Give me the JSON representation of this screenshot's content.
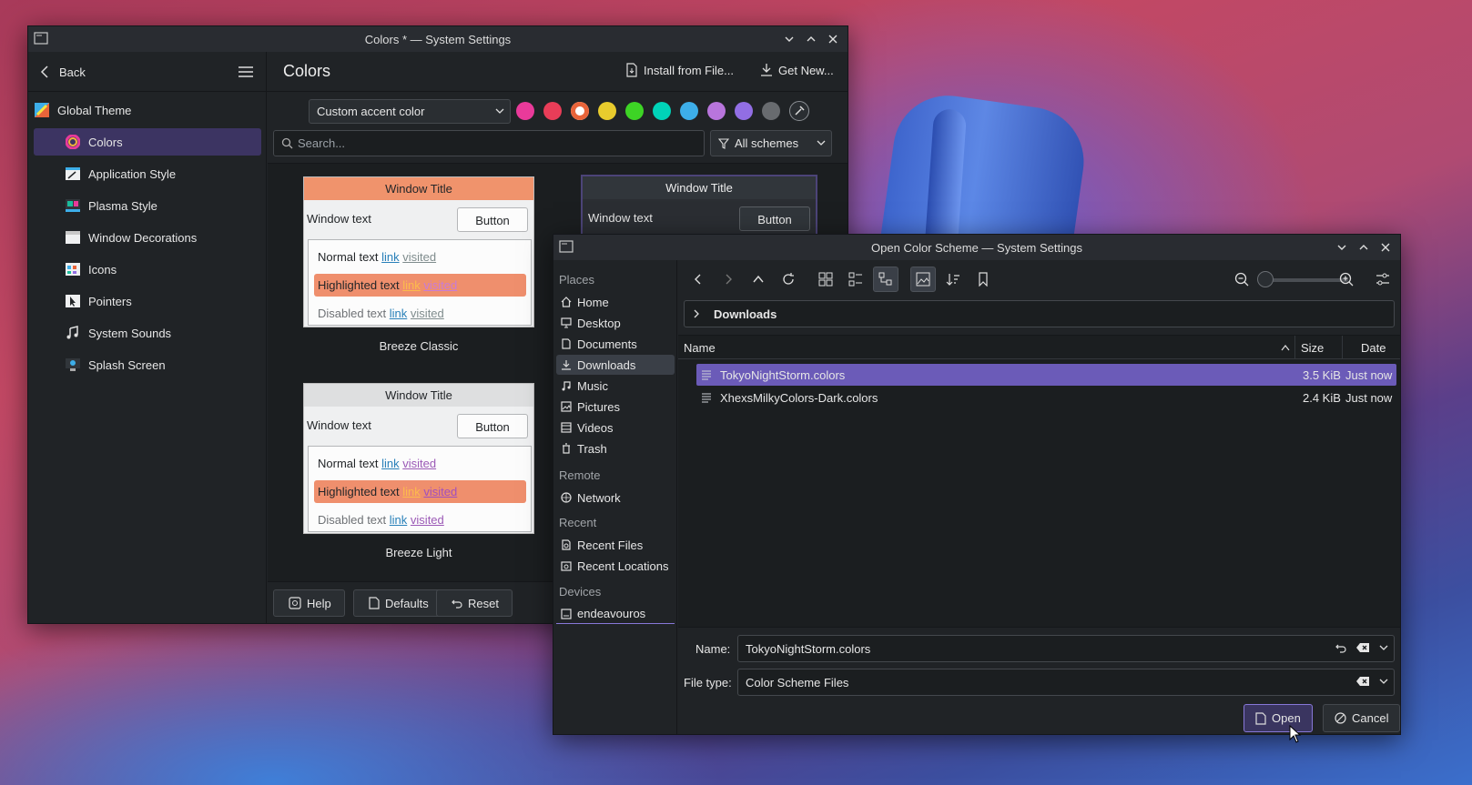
{
  "settings_window": {
    "title": "Colors * — System Settings",
    "back_label": "Back",
    "page_title": "Colors",
    "install_label": "Install from File...",
    "get_new_label": "Get New...",
    "sidebar": [
      {
        "label": "Global Theme",
        "icon": "global-theme-icon"
      },
      {
        "label": "Colors",
        "icon": "colors-icon",
        "active": true
      },
      {
        "label": "Application Style",
        "icon": "application-style-icon"
      },
      {
        "label": "Plasma Style",
        "icon": "plasma-style-icon"
      },
      {
        "label": "Window Decorations",
        "icon": "window-decorations-icon"
      },
      {
        "label": "Icons",
        "icon": "icons-icon"
      },
      {
        "label": "Pointers",
        "icon": "pointers-icon"
      },
      {
        "label": "System Sounds",
        "icon": "system-sounds-icon"
      },
      {
        "label": "Splash Screen",
        "icon": "splash-screen-icon"
      }
    ],
    "accent_select": "Custom accent color",
    "accent_colors": [
      "#e93a9a",
      "#e93d58",
      "#e9643a",
      "#e8cb2d",
      "#3dd425",
      "#00d3b8",
      "#3daee9",
      "#b875dc",
      "#926ee4",
      "#686b6f"
    ],
    "search_placeholder": "Search...",
    "schemes_filter": "All schemes",
    "previews": [
      {
        "window_title": "Window Title",
        "window_text": "Window text",
        "button": "Button",
        "normal_text": "Normal text",
        "highlighted_text": "Highlighted text",
        "disabled_text": "Disabled text",
        "link": "link",
        "visited": "visited",
        "caption": "Breeze Classic",
        "title_bg": "#f0936c",
        "highlight_bg": "#ef8f6d"
      },
      {
        "window_title": "Window Title",
        "window_text": "Window text",
        "button": "Button",
        "caption": ""
      },
      {
        "window_title": "Window Title",
        "window_text": "Window text",
        "button": "Button",
        "normal_text": "Normal text",
        "highlighted_text": "Highlighted text",
        "disabled_text": "Disabled text",
        "link": "link",
        "visited": "visited",
        "caption": "Breeze Light",
        "title_bg": "#dedfe0",
        "highlight_bg": "#ef8f6d"
      }
    ],
    "help_label": "Help",
    "defaults_label": "Defaults",
    "reset_label": "Reset"
  },
  "dialog": {
    "title": "Open Color Scheme — System Settings",
    "places_header": "Places",
    "places": [
      {
        "label": "Home",
        "icon": "home-icon"
      },
      {
        "label": "Desktop",
        "icon": "desktop-icon"
      },
      {
        "label": "Documents",
        "icon": "documents-icon"
      },
      {
        "label": "Downloads",
        "icon": "downloads-icon",
        "active": true
      },
      {
        "label": "Music",
        "icon": "music-icon"
      },
      {
        "label": "Pictures",
        "icon": "pictures-icon"
      },
      {
        "label": "Videos",
        "icon": "videos-icon"
      },
      {
        "label": "Trash",
        "icon": "trash-icon"
      }
    ],
    "remote_header": "Remote",
    "remote": [
      {
        "label": "Network",
        "icon": "network-icon"
      }
    ],
    "recent_header": "Recent",
    "recent": [
      {
        "label": "Recent Files",
        "icon": "recent-files-icon"
      },
      {
        "label": "Recent Locations",
        "icon": "recent-locations-icon"
      }
    ],
    "devices_header": "Devices",
    "devices": [
      {
        "label": "endeavouros",
        "icon": "drive-icon"
      }
    ],
    "breadcrumb": "Downloads",
    "columns": {
      "name": "Name",
      "size": "Size",
      "date": "Date"
    },
    "files": [
      {
        "name": "TokyoNightStorm.colors",
        "size": "3.5 KiB",
        "date": "Just now",
        "selected": true
      },
      {
        "name": "XhexsMilkyColors-Dark.colors",
        "size": "2.4 KiB",
        "date": "Just now",
        "selected": false
      }
    ],
    "name_label": "Name:",
    "name_value": "TokyoNightStorm.colors",
    "filetype_label": "File type:",
    "filetype_value": "Color Scheme Files",
    "open_label": "Open",
    "cancel_label": "Cancel"
  }
}
